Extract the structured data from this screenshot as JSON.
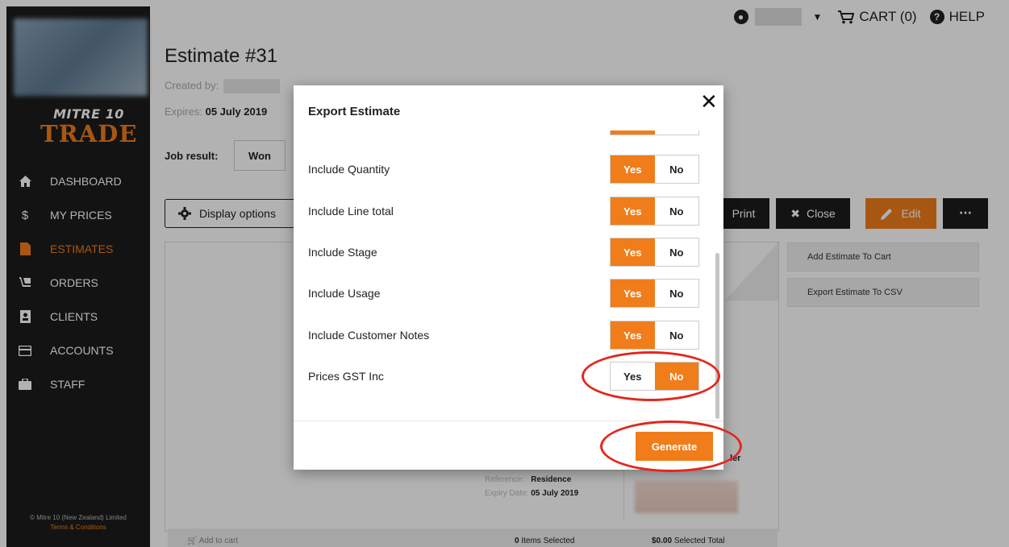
{
  "sidebar": {
    "brand_top": "MITRE 10",
    "brand_bottom": "TRADE",
    "items": [
      {
        "label": "DASHBOARD",
        "icon": "home-icon"
      },
      {
        "label": "MY PRICES",
        "icon": "dollar-icon"
      },
      {
        "label": "ESTIMATES",
        "icon": "document-icon"
      },
      {
        "label": "ORDERS",
        "icon": "truck-icon"
      },
      {
        "label": "CLIENTS",
        "icon": "contact-icon"
      },
      {
        "label": "ACCOUNTS",
        "icon": "card-icon"
      },
      {
        "label": "STAFF",
        "icon": "briefcase-icon"
      }
    ],
    "active_item": "ESTIMATES",
    "footer_text": "© Mitre 10 (New Zealand) Limited",
    "footer_link": "Terms & Conditions"
  },
  "topbar": {
    "cart_label": "CART (0)",
    "help_label": "HELP"
  },
  "page": {
    "title": "Estimate #31",
    "created_by_label": "Created by:",
    "expires_label": "Expires:",
    "expires_value": "05 July 2019",
    "job_result_label": "Job result:",
    "job_result_value": "Won",
    "display_options_label": "Display options",
    "print_label": "Print",
    "close_label": "Close",
    "edit_label": "Edit",
    "more_label": "···",
    "add_to_cart_action": "Add Estimate To Cart",
    "export_csv_action": "Export Estimate To CSV"
  },
  "preview": {
    "reference_label": "Reference:",
    "reference_value": "Residence",
    "expiry_label": "Expiry Date:",
    "expiry_value": "05 July 2019",
    "ler_text": "ler",
    "add_to_cart": "Add to cart",
    "items_selected_count": "0",
    "items_selected_label": "Items Selected",
    "selected_total_value": "$0.00",
    "selected_total_label": "Selected Total"
  },
  "modal": {
    "title": "Export Estimate",
    "yes_label": "Yes",
    "no_label": "No",
    "options": [
      {
        "label": "Include Quantity",
        "value": "Yes"
      },
      {
        "label": "Include Line total",
        "value": "Yes"
      },
      {
        "label": "Include Stage",
        "value": "Yes"
      },
      {
        "label": "Include Usage",
        "value": "Yes"
      },
      {
        "label": "Include Customer Notes",
        "value": "Yes"
      },
      {
        "label": "Prices GST Inc",
        "value": "No"
      }
    ],
    "generate_label": "Generate"
  },
  "colors": {
    "accent": "#f07d1a",
    "sidebar_bg": "#1c1c1c",
    "annotation": "#e3271e"
  }
}
